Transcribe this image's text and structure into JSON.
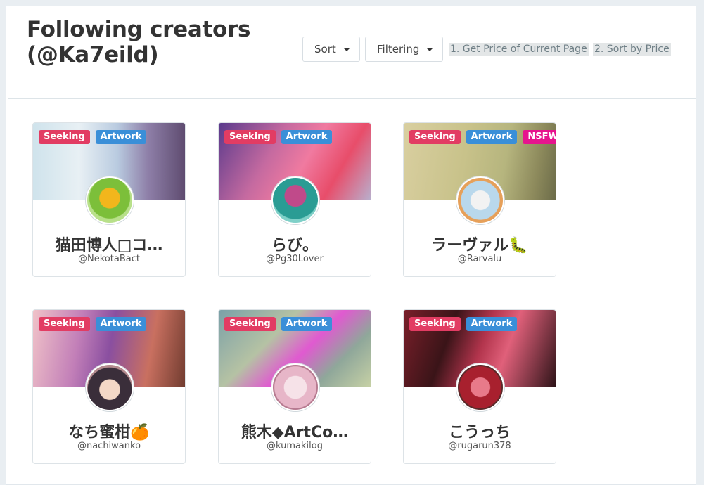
{
  "header": {
    "title": "Following creators (@Ka7eild)",
    "sort_label": "Sort",
    "filter_label": "Filtering",
    "link1": "1. Get Price of Current Page",
    "link2": "2. Sort by Price"
  },
  "colors": {
    "seeking_badge": "#e23c63",
    "artwork_badge": "#3a8fd8",
    "nsfw_badge": "#e6148e"
  },
  "creators": [
    {
      "name": "猫田博人□コ…",
      "handle": "@NekotaBact",
      "badges": [
        "Seeking",
        "Artwork"
      ]
    },
    {
      "name": "らび。",
      "handle": "@Pg30Lover",
      "badges": [
        "Seeking",
        "Artwork"
      ]
    },
    {
      "name": "ラーヴァル🐛",
      "handle": "@Rarvalu",
      "badges": [
        "Seeking",
        "Artwork",
        "NSFW"
      ]
    },
    {
      "name": "なち蜜柑🍊",
      "handle": "@nachiwanko",
      "badges": [
        "Seeking",
        "Artwork"
      ]
    },
    {
      "name": "熊木◆ArtCo…",
      "handle": "@kumakilog",
      "badges": [
        "Seeking",
        "Artwork"
      ]
    },
    {
      "name": "こうっち",
      "handle": "@rugarun378",
      "badges": [
        "Seeking",
        "Artwork"
      ]
    }
  ]
}
